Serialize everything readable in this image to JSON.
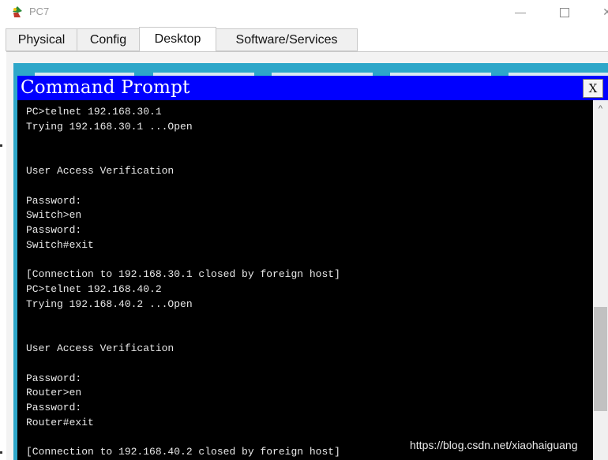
{
  "window": {
    "title": "PC7",
    "icon": "packet-tracer-pc-icon",
    "min_glyph": "—",
    "close_glyph": "✕"
  },
  "tabs": [
    {
      "label": "Physical",
      "active": false
    },
    {
      "label": "Config",
      "active": false
    },
    {
      "label": "Desktop",
      "active": true
    },
    {
      "label": "Software/Services",
      "active": false
    }
  ],
  "cmd": {
    "title": "Command Prompt",
    "close_label": "X",
    "lines": [
      "PC>telnet 192.168.30.1",
      "Trying 192.168.30.1 ...Open",
      "",
      "",
      "User Access Verification",
      "",
      "Password:",
      "Switch>en",
      "Password:",
      "Switch#exit",
      "",
      "[Connection to 192.168.30.1 closed by foreign host]",
      "PC>telnet 192.168.40.2",
      "Trying 192.168.40.2 ...Open",
      "",
      "",
      "User Access Verification",
      "",
      "Password:",
      "Router>en",
      "Password:",
      "Router#exit",
      "",
      "[Connection to 192.168.40.2 closed by foreign host]"
    ]
  },
  "scrollbar": {
    "up_glyph": "^",
    "position": 0.58
  },
  "watermark": "https://blog.csdn.net/xiaohaiguang",
  "colors": {
    "cmd_titlebar": "#0000ff",
    "terminal_bg": "#000000",
    "terminal_text": "#e8e8e8",
    "desktop_bg": "#2ea7c9"
  }
}
